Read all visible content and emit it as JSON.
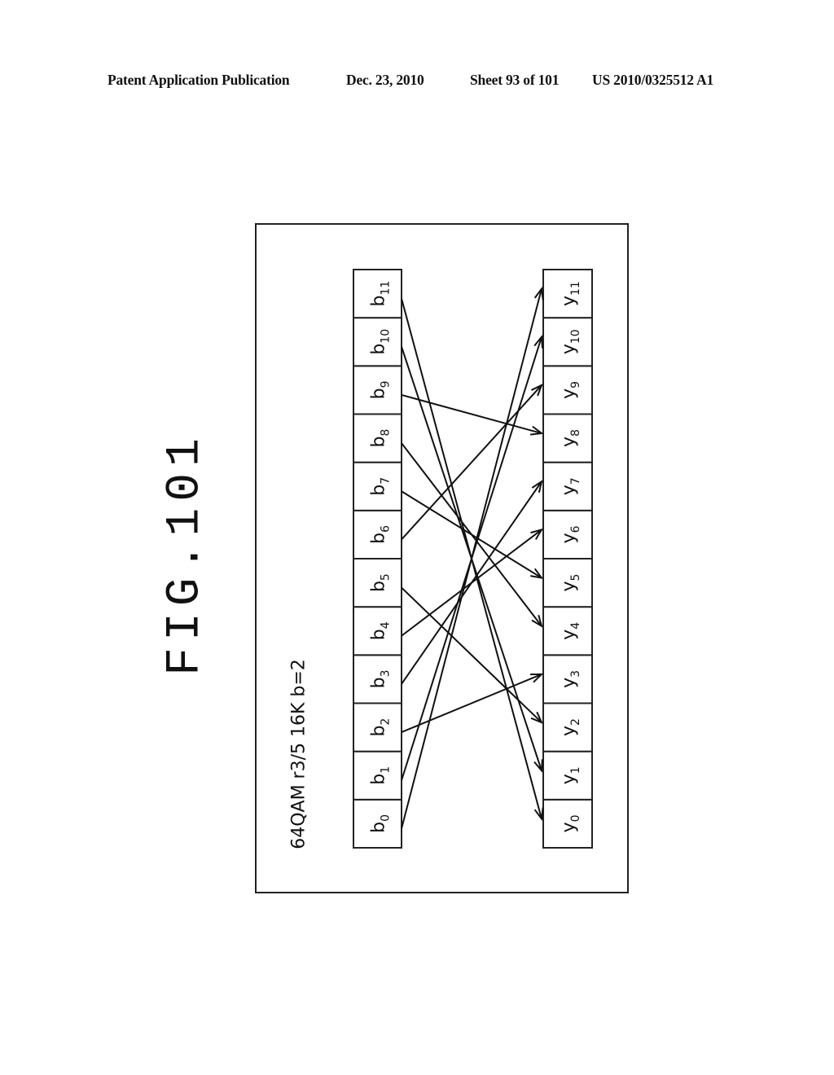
{
  "header": {
    "publication": "Patent Application Publication",
    "date": "Dec. 23, 2010",
    "sheet": "Sheet 93 of 101",
    "patent_number": "US 2010/0325512 A1"
  },
  "figure": {
    "title": "FIG.101",
    "caption": "64QAM r3/5 16K b=2"
  },
  "input_bits": [
    {
      "base": "b",
      "index": "0"
    },
    {
      "base": "b",
      "index": "1"
    },
    {
      "base": "b",
      "index": "2"
    },
    {
      "base": "b",
      "index": "3"
    },
    {
      "base": "b",
      "index": "4"
    },
    {
      "base": "b",
      "index": "5"
    },
    {
      "base": "b",
      "index": "6"
    },
    {
      "base": "b",
      "index": "7"
    },
    {
      "base": "b",
      "index": "8"
    },
    {
      "base": "b",
      "index": "9"
    },
    {
      "base": "b",
      "index": "10"
    },
    {
      "base": "b",
      "index": "11"
    }
  ],
  "output_symbols": [
    {
      "base": "y",
      "index": "0"
    },
    {
      "base": "y",
      "index": "1"
    },
    {
      "base": "y",
      "index": "2"
    },
    {
      "base": "y",
      "index": "3"
    },
    {
      "base": "y",
      "index": "4"
    },
    {
      "base": "y",
      "index": "5"
    },
    {
      "base": "y",
      "index": "6"
    },
    {
      "base": "y",
      "index": "7"
    },
    {
      "base": "y",
      "index": "8"
    },
    {
      "base": "y",
      "index": "9"
    },
    {
      "base": "y",
      "index": "10"
    },
    {
      "base": "y",
      "index": "11"
    }
  ],
  "mapping": [
    {
      "from": 0,
      "to": 11
    },
    {
      "from": 1,
      "to": 10
    },
    {
      "from": 2,
      "to": 3
    },
    {
      "from": 3,
      "to": 7
    },
    {
      "from": 4,
      "to": 6
    },
    {
      "from": 5,
      "to": 2
    },
    {
      "from": 6,
      "to": 9
    },
    {
      "from": 7,
      "to": 5
    },
    {
      "from": 8,
      "to": 4
    },
    {
      "from": 9,
      "to": 8
    },
    {
      "from": 10,
      "to": 1
    },
    {
      "from": 11,
      "to": 0
    }
  ]
}
